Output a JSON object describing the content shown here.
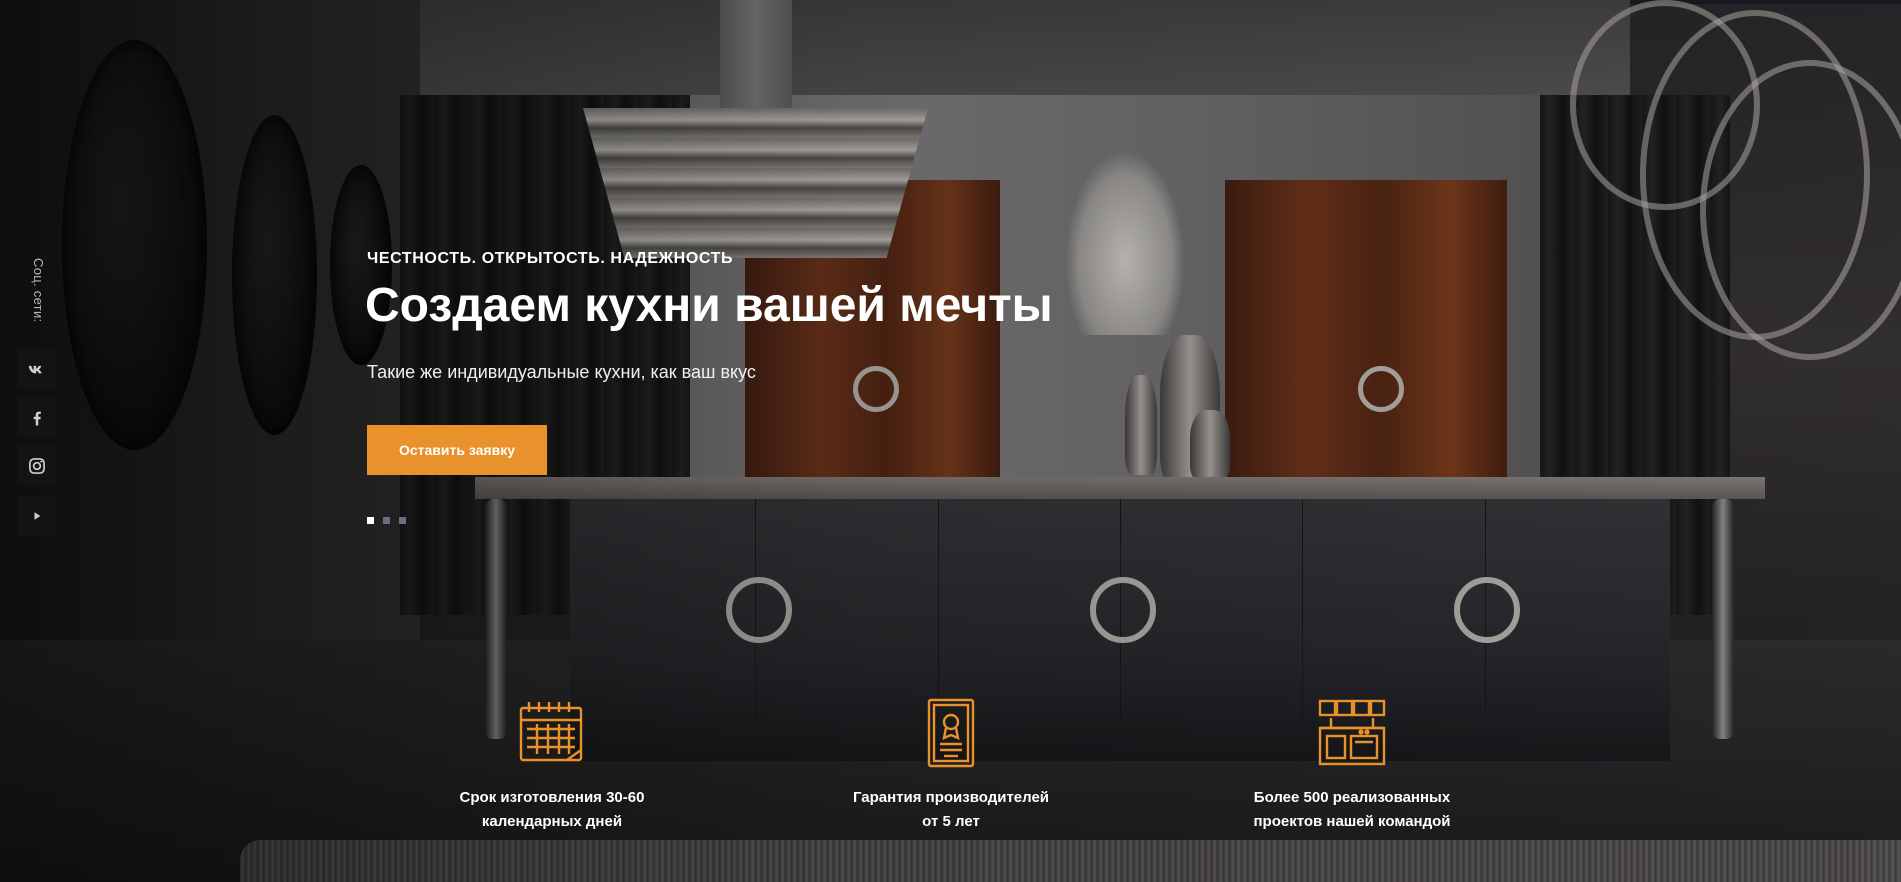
{
  "social": {
    "label": "Соц. сети:",
    "items": [
      {
        "name": "vk",
        "icon": "vk-icon"
      },
      {
        "name": "facebook",
        "icon": "facebook-icon"
      },
      {
        "name": "instagram",
        "icon": "instagram-icon"
      },
      {
        "name": "youtube",
        "icon": "play-icon"
      }
    ]
  },
  "hero": {
    "eyebrow": "ЧЕСТНОСТЬ. ОТКРЫТОСТЬ. НАДЕЖНОСТЬ",
    "title": "Создаем кухни вашей мечты",
    "subtitle": "Такие же индивидуальные кухни, как ваш вкус",
    "cta_label": "Оставить заявку",
    "slides_total": 3,
    "active_slide": 1
  },
  "features": [
    {
      "icon": "calendar-icon",
      "text_line1": "Срок изготовления 30-60",
      "text_line2": "календарных дней"
    },
    {
      "icon": "certificate-icon",
      "text_line1": "Гарантия производителей",
      "text_line2": "от 5 лет"
    },
    {
      "icon": "kitchen-icon",
      "text_line1": "Более 500 реализованных",
      "text_line2": "проектов нашей командой"
    }
  ],
  "colors": {
    "accent": "#e9912a",
    "dot_active": "#ffffff",
    "dot_inactive": "#6a6f80"
  }
}
